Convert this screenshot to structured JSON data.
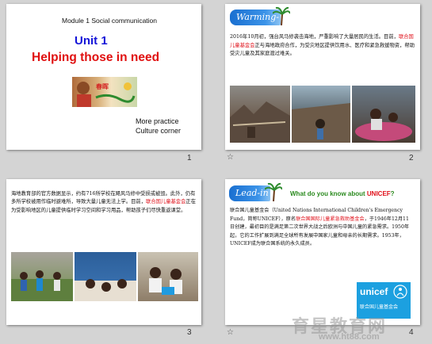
{
  "slides": [
    {
      "module": "Module 1 Social communication",
      "unit": "Unit 1",
      "title": "Helping those in need",
      "menu": [
        "More practice",
        "Culture corner"
      ],
      "number": "1"
    },
    {
      "section": "Warming-up",
      "text_pre": "2016年10月初，强台风马修袭击海地，严重影响了大量居民的生活。目前，",
      "text_red": "联合国儿童基金会",
      "text_post": "正与海地政府合作，为受灾地区提供饮用水、医疗和紧急救援物资，帮助受灾儿童及其家庭渡过难关。",
      "star": "☆",
      "number": "2"
    },
    {
      "text_pre": "海地教育部的官方数据显示，约有716所学校在飓风马修中受损或被毁。此外，仍有多所学校被用作临时避难所，导致大量儿童无法上学。目前，",
      "text_red": "联合国儿童基金会",
      "text_post": "正在为受影响地区的儿童提供临时学习空间和学习用品，帮助孩子们尽快重返课堂。",
      "number": "3"
    },
    {
      "section": "Lead-in",
      "question_pre": "What do you know about ",
      "question_red": "UNICEF",
      "question_post": "?",
      "text_pre": "联合国儿童基金会（United Nations International Children's Emergency Fund，简称UNICEF），原名",
      "text_red": "联合国国际儿童紧急救助基金会",
      "text_post": "，于1946年12月11日创建，最初目的是满足第二次世界大战之后欧洲与中国儿童的紧急需求。1950年起，它的工作扩展到满足全球所有发展中国家儿童和母亲的长期需求。1953年，UNICEF成为联合国系统的永久成员。",
      "logo_name": "unicef",
      "logo_cn": "联合国儿童基金会",
      "star": "☆",
      "number": "4"
    }
  ],
  "watermark": {
    "cn": "育星教育网",
    "url": "www.ht88.com"
  }
}
